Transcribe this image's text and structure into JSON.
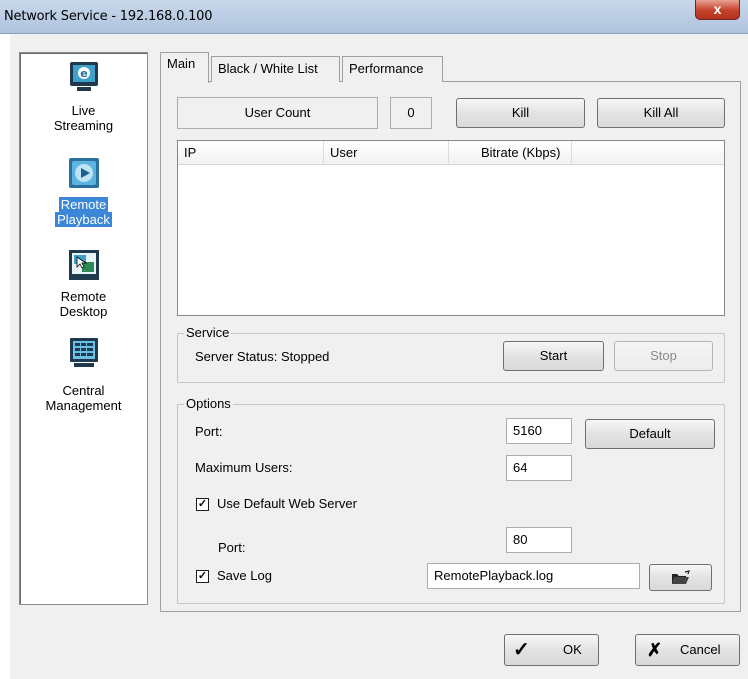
{
  "window": {
    "title": "Network Service - 192.168.0.100",
    "close_glyph": "x"
  },
  "sidebar": {
    "items": [
      {
        "label_line1": "Live",
        "label_line2": "Streaming",
        "icon": "monitor-icon",
        "selected": false
      },
      {
        "label_line1": "Remote",
        "label_line2": "Playback",
        "icon": "playback-icon",
        "selected": true
      },
      {
        "label_line1": "Remote",
        "label_line2": "Desktop",
        "icon": "remote-desktop-icon",
        "selected": false
      },
      {
        "label_line1": "Central",
        "label_line2": "Management",
        "icon": "central-management-icon",
        "selected": false
      }
    ]
  },
  "tabs": [
    {
      "label": "Main",
      "active": true
    },
    {
      "label": "Black / White List",
      "active": false
    },
    {
      "label": "Performance",
      "active": false
    }
  ],
  "main": {
    "user_count_label": "User Count",
    "user_count_value": "0",
    "kill_label": "Kill",
    "kill_all_label": "Kill All",
    "table": {
      "columns": [
        "IP",
        "User",
        "Bitrate (Kbps)"
      ],
      "rows": []
    },
    "service": {
      "group_label": "Service",
      "status_text": "Server Status: Stopped",
      "start_label": "Start",
      "stop_label": "Stop"
    },
    "options": {
      "group_label": "Options",
      "port_label": "Port:",
      "port_value": "5160",
      "default_label": "Default",
      "max_users_label": "Maximum Users:",
      "max_users_value": "64",
      "use_default_web_server_label": "Use Default Web Server",
      "use_default_web_server_checked": true,
      "web_port_label": "Port:",
      "web_port_value": "80",
      "save_log_label": "Save Log",
      "save_log_checked": true,
      "log_file_value": "RemotePlayback.log",
      "browse_icon": "folder-open-icon"
    }
  },
  "footer": {
    "ok_label": "OK",
    "cancel_label": "Cancel"
  }
}
